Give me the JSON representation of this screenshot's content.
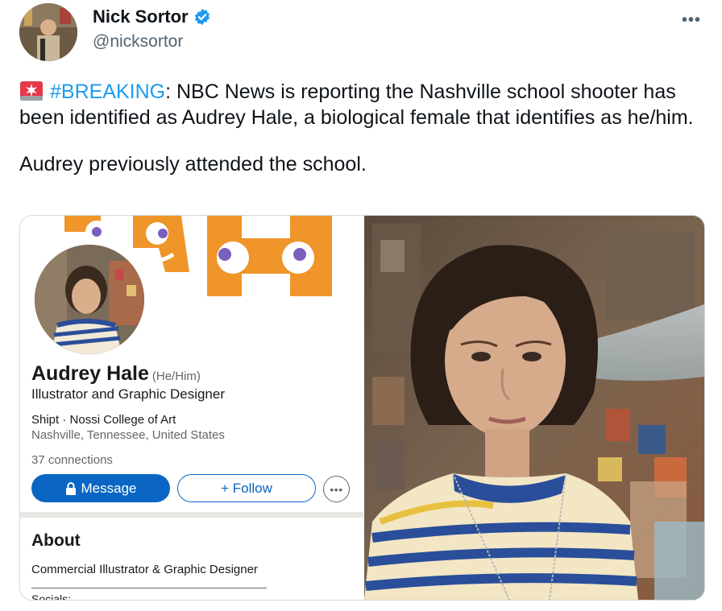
{
  "tweet": {
    "author_name": "Nick Sortor",
    "author_handle": "@nicksortor",
    "more_label": "•••",
    "hashtag": "#BREAKING",
    "text_line1_rest": ": NBC News is reporting the Nashville school shooter has been identified as Audrey Hale, a biological female that identifies as he/him.",
    "text_line2": "Audrey previously attended the school."
  },
  "profile": {
    "name": "Audrey Hale",
    "pronouns": "(He/Him)",
    "headline": "Illustrator and Graphic Designer",
    "org": "Shipt · Nossi College of Art",
    "location": "Nashville, Tennessee, United States",
    "connections": "37 connections",
    "message_label": "Message",
    "follow_label": "+ Follow",
    "more_label": "•••",
    "about_title": "About",
    "about_text": "Commercial Illustrator & Graphic Designer",
    "socials_label": "Socials:"
  },
  "colors": {
    "hashtag": "#1d9bf0",
    "verified": "#1d9bf0",
    "linkedin_blue": "#0a66c2",
    "banner_orange": "#f0952a"
  },
  "icons": [
    "verified-badge-icon",
    "siren-emoji-icon",
    "more-icon",
    "lock-icon"
  ]
}
